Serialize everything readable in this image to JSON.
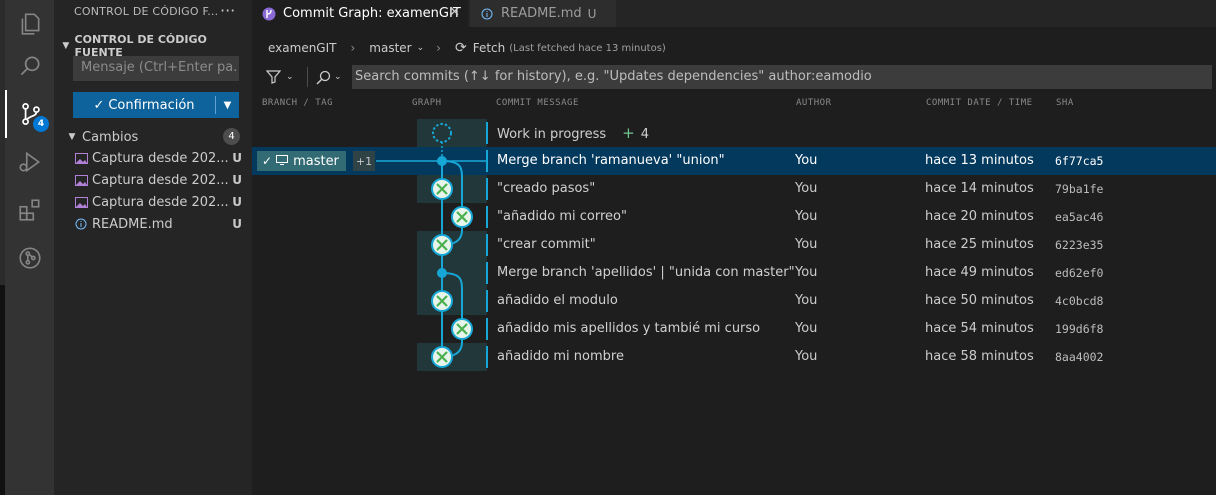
{
  "activity": {
    "scm_badge": "4"
  },
  "sidebar": {
    "title": "CONTROL DE CÓDIGO F...",
    "more": "···",
    "section": "CONTROL DE CÓDIGO FUENTE",
    "message_placeholder": "Mensaje (Ctrl+Enter pa...",
    "commit_label": "Confirmación",
    "changes_label": "Cambios",
    "changes_count": "4",
    "files": [
      {
        "name": "Captura desde 202...",
        "status": "U"
      },
      {
        "name": "Captura desde 202...",
        "status": "U"
      },
      {
        "name": "Captura desde 202...",
        "status": "U"
      },
      {
        "name": "README.md",
        "status": "U"
      }
    ]
  },
  "tabs": [
    {
      "label": "Commit Graph: examenGIT",
      "close": "✕"
    },
    {
      "label": "README.md",
      "badge": "U"
    }
  ],
  "breadcrumb": {
    "repo": "examenGIT",
    "branch": "master",
    "fetch": "Fetch",
    "fetched": "(Last fetched hace 13 minutos)"
  },
  "search": {
    "placeholder": "Search commits (↑↓ for history), e.g. \"Updates dependencies\" author:eamodio"
  },
  "columns": {
    "branch": "BRANCH / TAG",
    "graph": "GRAPH",
    "message": "COMMIT MESSAGE",
    "author": "AUTHOR",
    "date": "COMMIT DATE / TIME",
    "sha": "SHA"
  },
  "wip": {
    "label": "Work in progress",
    "plus": "+",
    "count": "4"
  },
  "branch_tag": {
    "name": "master",
    "extra": "+1"
  },
  "commits": [
    {
      "message": "Merge branch 'ramanueva' \"union\"",
      "author": "You",
      "date": "hace 13 minutos",
      "sha": "6f77ca5"
    },
    {
      "message": "\"creado pasos\"",
      "author": "You",
      "date": "hace 14 minutos",
      "sha": "79ba1fe"
    },
    {
      "message": "\"añadido mi correo\"",
      "author": "You",
      "date": "hace 20 minutos",
      "sha": "ea5ac46"
    },
    {
      "message": "\"crear commit\"",
      "author": "You",
      "date": "hace 25 minutos",
      "sha": "6223e35"
    },
    {
      "message": "Merge branch 'apellidos' | \"unida con master\"",
      "author": "You",
      "date": "hace 49 minutos",
      "sha": "ed62ef0"
    },
    {
      "message": "añadido el modulo",
      "author": "You",
      "date": "hace 50 minutos",
      "sha": "4c0bcd8"
    },
    {
      "message": "añadido mis apellidos y tambié mi curso",
      "author": "You",
      "date": "hace 54 minutos",
      "sha": "199d6f8"
    },
    {
      "message": "añadido mi nombre",
      "author": "You",
      "date": "hace 58 minutos",
      "sha": "8aa4002"
    }
  ]
}
